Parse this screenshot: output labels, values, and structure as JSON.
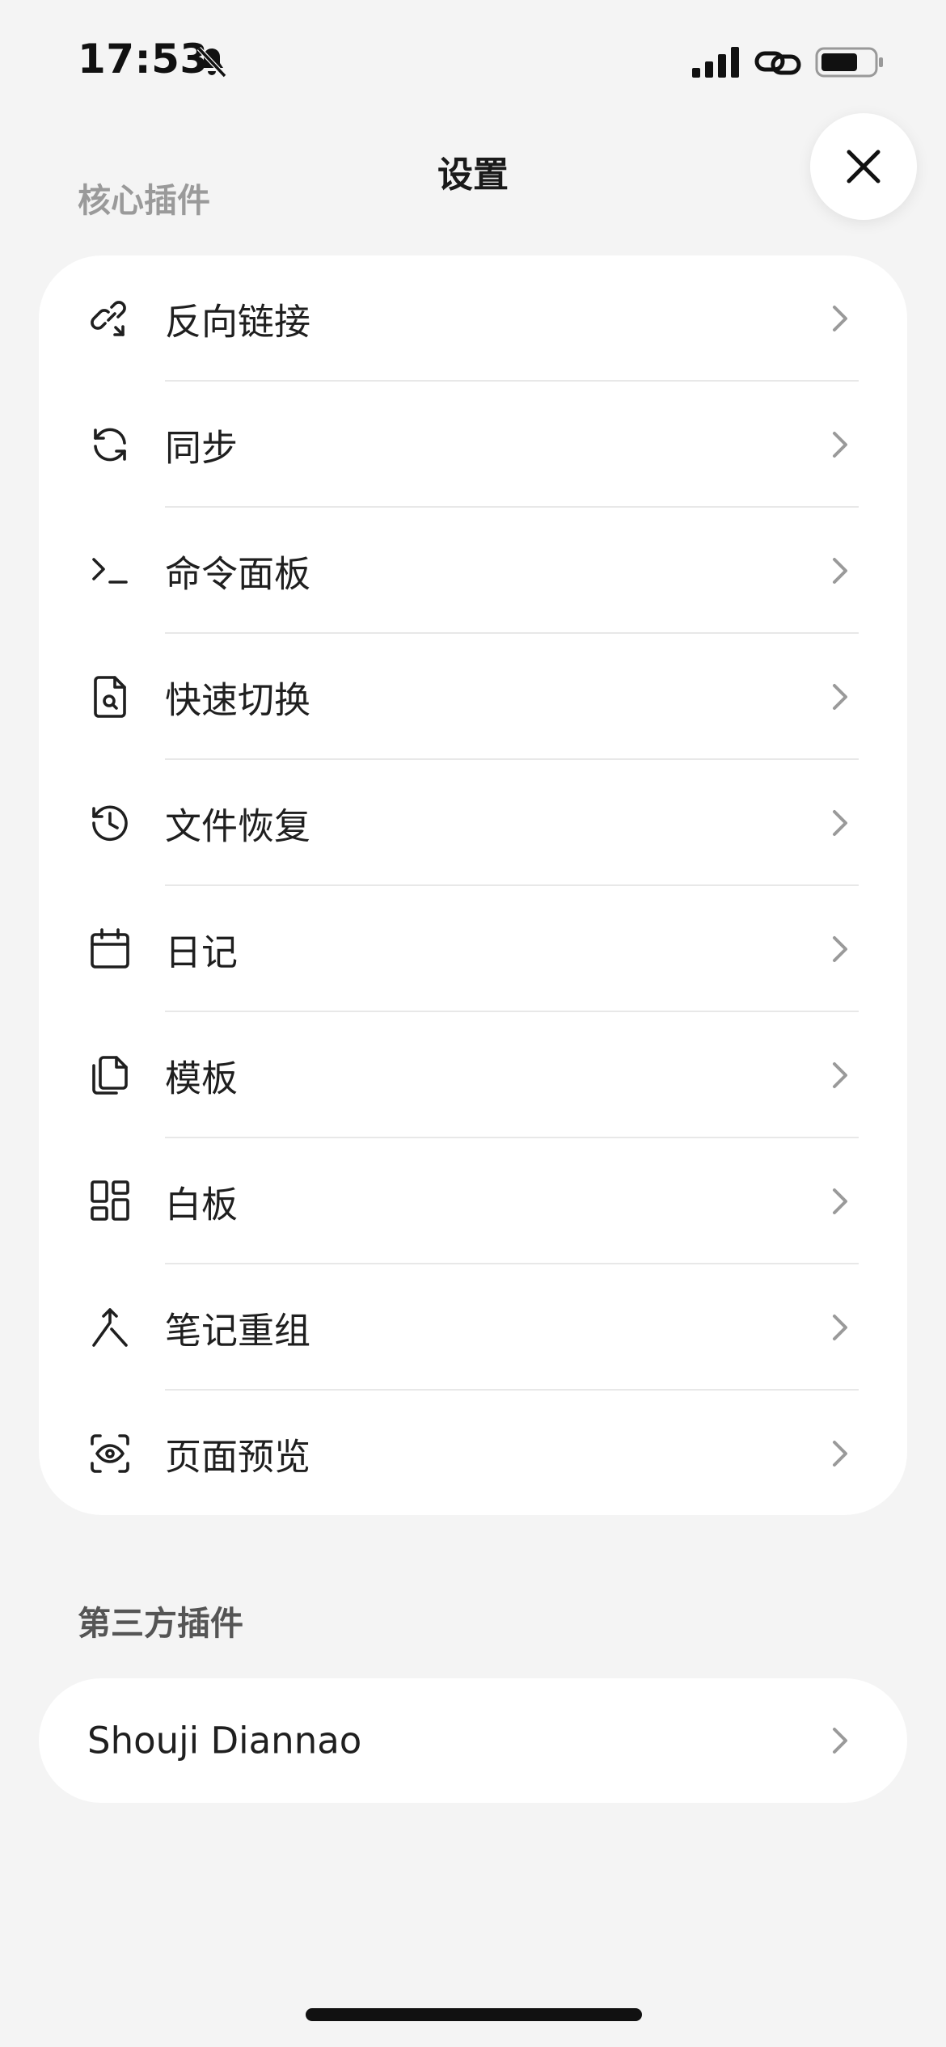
{
  "status_bar": {
    "time": "17:53",
    "icons": [
      "bell-slash-icon",
      "signal-icon",
      "link-icon",
      "battery-icon"
    ]
  },
  "header": {
    "title": "设置",
    "close_icon": "close-icon"
  },
  "core_plugins": {
    "section_label": "核心插件",
    "items": [
      {
        "label": "反向链接",
        "icon": "backlink-icon"
      },
      {
        "label": "同步",
        "icon": "sync-icon"
      },
      {
        "label": "命令面板",
        "icon": "terminal-icon"
      },
      {
        "label": "快速切换",
        "icon": "file-search-icon"
      },
      {
        "label": "文件恢复",
        "icon": "history-icon"
      },
      {
        "label": "日记",
        "icon": "calendar-icon"
      },
      {
        "label": "模板",
        "icon": "files-icon"
      },
      {
        "label": "白板",
        "icon": "layout-dashboard-icon"
      },
      {
        "label": "笔记重组",
        "icon": "merge-icon"
      },
      {
        "label": "页面预览",
        "icon": "scan-eye-icon"
      }
    ]
  },
  "third_party_plugins": {
    "section_label": "第三方插件",
    "items": [
      {
        "label": "Shouji Diannao"
      }
    ]
  },
  "colors": {
    "background": "#f4f4f4",
    "card": "#ffffff",
    "text": "#1f1f1f",
    "section_label": "#9a9a9a",
    "chevron": "#9a9a9a"
  }
}
